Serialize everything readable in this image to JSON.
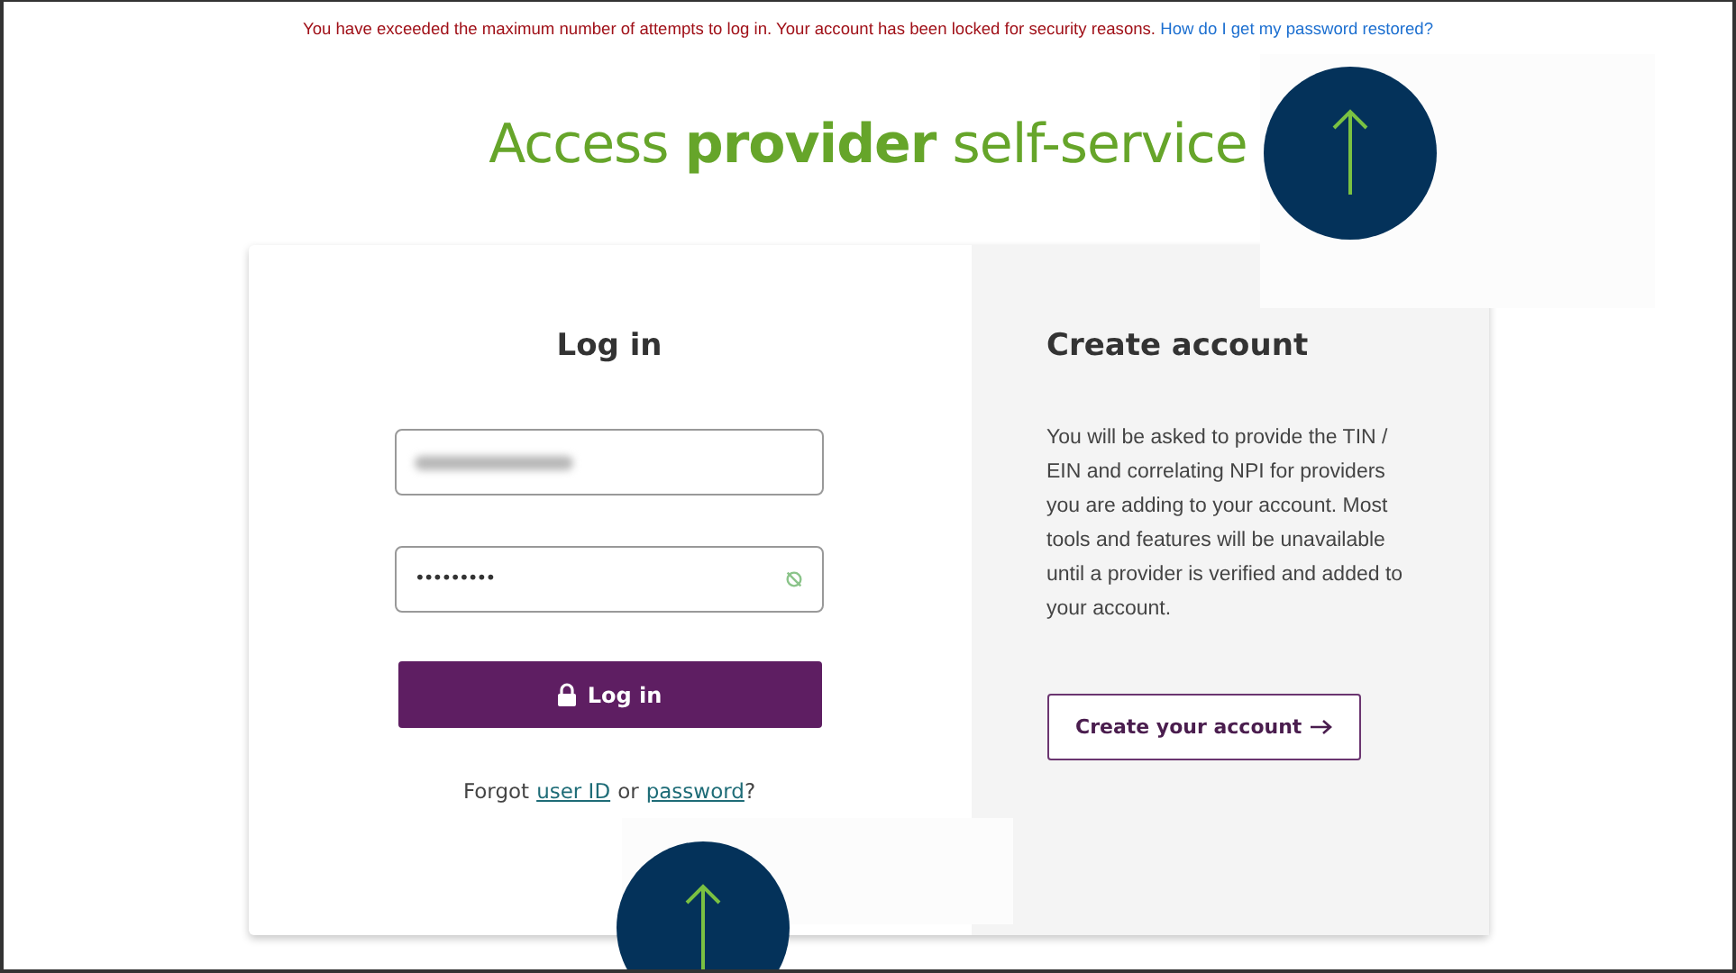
{
  "alert": {
    "message": "You have exceeded the maximum number of attempts to log in. Your account has been locked for security reasons.",
    "link": "How do I get my password restored?"
  },
  "title": "Access **provider** self-service",
  "login": {
    "heading": "Log in",
    "username": {
      "blurred": true
    },
    "password": {
      "value": "•••••••••"
    },
    "button": "Log in",
    "forgot": {
      "prefix": "Forgot",
      "user_link": "user ID",
      "middle": "or",
      "password_link": "password",
      "suffix": "?"
    }
  },
  "create": {
    "heading": "Create account",
    "text": "You will be asked to provide the TIN / EIN and correlating NPI for providers you are adding to your account. Most tools and features will be unavailable until a provider is verified and added to your account.",
    "button": "Create your account"
  },
  "markers": [
    {
      "kind": "arrow-up"
    },
    {
      "kind": "arrow-up"
    }
  ]
}
